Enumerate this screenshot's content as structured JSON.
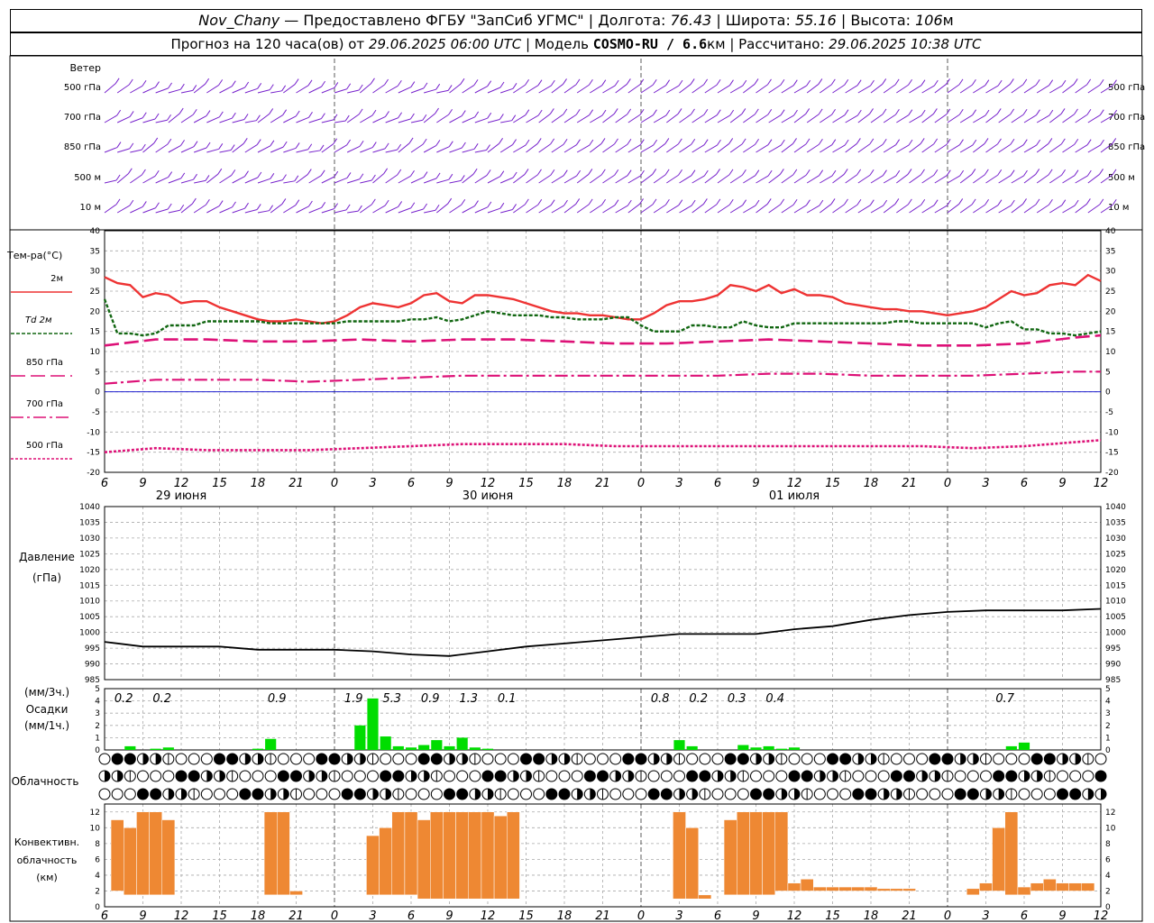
{
  "header": {
    "station": "Nov_Chany",
    "provider": " — Предоставлено ФГБУ \"ЗапСиб УГМС\" | ",
    "lon_label": "Долгота: ",
    "lon": "76.43",
    "lat_label": " | Широта: ",
    "lat": "55.16",
    "alt_label": " | Высота: ",
    "alt": "106",
    "alt_unit": "м",
    "forecast_label": "Прогноз на 120 часа(ов) от ",
    "forecast_from": "29.06.2025 06:00 UTC",
    "model_label": "  | Модель ",
    "model": "COSMO-RU / 6.6",
    "model_unit": "км",
    "calc_label": " | Рассчитано: ",
    "calc_time": "29.06.2025 10:38 UTC"
  },
  "colors": {
    "t2m": "#ee3333",
    "td2m": "#116611",
    "t850": "#dd1177",
    "t700": "#dd1177",
    "t500": "#dd1177",
    "pressure": "#000000",
    "precip": "#00dd00",
    "convective": "#ee8833",
    "wind": "#7722cc",
    "zero_line": "#0000cc"
  },
  "axis": {
    "time_ticks": [
      "6",
      "9",
      "12",
      "15",
      "18",
      "21",
      "0",
      "3",
      "6",
      "9",
      "12",
      "15",
      "18",
      "21",
      "0",
      "3",
      "6",
      "9",
      "12",
      "15",
      "18",
      "21",
      "0",
      "3",
      "6",
      "9",
      "12"
    ],
    "day_labels": [
      "29 июня",
      "30 июня",
      "01 июля"
    ],
    "day_boundaries_hours": [
      18,
      42,
      66
    ]
  },
  "wind_panel": {
    "title": "Ветер",
    "levels": [
      "500 гПа",
      "700 гПа",
      "850 гПа",
      "500 м",
      "10  м"
    ]
  },
  "cloud_panel": {
    "title": "Облачность"
  },
  "chart_data": [
    {
      "type": "line",
      "panel": "temperature",
      "title": "Тем-ра(°C)",
      "x_unit": "hours from 29.06.2025 06 UTC",
      "ylim": [
        -20,
        40
      ],
      "yticks": [
        40,
        35,
        30,
        25,
        20,
        15,
        10,
        5,
        0,
        -5,
        -10,
        -15,
        -20
      ],
      "series": [
        {
          "name": "2м",
          "x": [
            0,
            1,
            2,
            3,
            4,
            5,
            6,
            7,
            8,
            9,
            10,
            11,
            12,
            13,
            14,
            15,
            16,
            17,
            18,
            19,
            20,
            21,
            22,
            23,
            24,
            25,
            26,
            27,
            28,
            29,
            30,
            31,
            32,
            33,
            34,
            35,
            36,
            37,
            38,
            39,
            40,
            41,
            42,
            43,
            44,
            45,
            46,
            47,
            48,
            49,
            50,
            51,
            52,
            53,
            54,
            55,
            56,
            57,
            58,
            59,
            60,
            61,
            62,
            63,
            64,
            65,
            66,
            67,
            68,
            69,
            70,
            71,
            72,
            73,
            74,
            75,
            76,
            77,
            78
          ],
          "values": [
            28.5,
            27,
            26.5,
            23.5,
            24.5,
            24,
            22,
            22.5,
            22.5,
            21,
            20,
            19,
            18,
            17.5,
            17.5,
            18,
            17.5,
            17,
            17.5,
            19,
            21,
            22,
            21.5,
            21,
            22,
            24,
            24.5,
            22.5,
            22,
            24,
            24,
            23.5,
            23,
            22,
            21,
            20,
            19.5,
            19.5,
            19,
            19,
            18.5,
            18,
            18,
            19.5,
            21.5,
            22.5,
            22.5,
            23,
            24,
            26.5,
            26,
            25,
            26.5,
            24.5,
            25.5,
            24,
            24,
            23.5,
            22,
            21.5,
            21,
            20.5,
            20.5,
            20,
            20,
            19.5,
            19,
            19.5,
            20,
            21,
            23,
            25,
            24,
            24.5,
            26.5,
            27,
            26.5,
            29,
            27.5
          ]
        },
        {
          "name": "Td  2м",
          "x": [
            0,
            1,
            2,
            3,
            4,
            5,
            6,
            7,
            8,
            9,
            10,
            11,
            12,
            13,
            14,
            15,
            16,
            17,
            18,
            19,
            20,
            21,
            22,
            23,
            24,
            25,
            26,
            27,
            28,
            29,
            30,
            31,
            32,
            33,
            34,
            35,
            36,
            37,
            38,
            39,
            40,
            41,
            42,
            43,
            44,
            45,
            46,
            47,
            48,
            49,
            50,
            51,
            52,
            53,
            54,
            55,
            56,
            57,
            58,
            59,
            60,
            61,
            62,
            63,
            64,
            65,
            66,
            67,
            68,
            69,
            70,
            71,
            72,
            73,
            74,
            75,
            76,
            77,
            78
          ],
          "values": [
            23,
            14.5,
            14.5,
            14,
            14.5,
            16.5,
            16.5,
            16.5,
            17.5,
            17.5,
            17.5,
            17.5,
            17.5,
            17,
            17,
            17,
            17,
            17,
            17,
            17.5,
            17.5,
            17.5,
            17.5,
            17.5,
            18,
            18,
            18.5,
            17.5,
            18,
            19,
            20,
            19.5,
            19,
            19,
            19,
            18.5,
            18.5,
            18,
            18,
            18,
            18.5,
            18.5,
            16.5,
            15,
            15,
            15,
            16.5,
            16.5,
            16,
            16,
            17.5,
            16.5,
            16,
            16,
            17,
            17,
            17,
            17,
            17,
            17,
            17,
            17,
            17.5,
            17.5,
            17,
            17,
            17,
            17,
            17,
            16,
            17,
            17.5,
            15.5,
            15.5,
            14.5,
            14.5,
            14,
            14.5,
            15
          ]
        },
        {
          "name": "850  гПа",
          "x": [
            0,
            4,
            8,
            12,
            16,
            20,
            24,
            28,
            32,
            36,
            40,
            44,
            48,
            52,
            56,
            60,
            64,
            68,
            72,
            76,
            78
          ],
          "values": [
            11.5,
            13,
            13,
            12.5,
            12.5,
            13,
            12.5,
            13,
            13,
            12.5,
            12,
            12,
            12.5,
            13,
            12.5,
            12,
            11.5,
            11.5,
            12,
            13.5,
            14
          ]
        },
        {
          "name": "700  гПа",
          "x": [
            0,
            4,
            8,
            12,
            16,
            20,
            24,
            28,
            32,
            36,
            40,
            44,
            48,
            52,
            56,
            60,
            64,
            68,
            72,
            76,
            78
          ],
          "values": [
            2,
            3,
            3,
            3,
            2.5,
            3,
            3.5,
            4,
            4,
            4,
            4,
            4,
            4,
            4.5,
            4.5,
            4,
            4,
            4,
            4.5,
            5,
            5
          ]
        },
        {
          "name": "500  гПа",
          "x": [
            0,
            4,
            8,
            12,
            16,
            20,
            24,
            28,
            32,
            36,
            40,
            44,
            48,
            52,
            56,
            60,
            64,
            68,
            72,
            76,
            78
          ],
          "values": [
            -15,
            -14,
            -14.5,
            -14.5,
            -14.5,
            -14,
            -13.5,
            -13,
            -13,
            -13,
            -13.5,
            -13.5,
            -13.5,
            -13.5,
            -13.5,
            -13.5,
            -13.5,
            -14,
            -13.5,
            -12.5,
            -12
          ]
        }
      ]
    },
    {
      "type": "line",
      "panel": "pressure",
      "title": "Давление",
      "ylabel": "(гПа)",
      "ylim": [
        985,
        1040
      ],
      "yticks": [
        1040,
        1035,
        1030,
        1025,
        1020,
        1015,
        1010,
        1005,
        1000,
        995,
        990,
        985
      ],
      "series": [
        {
          "name": "Давление",
          "x": [
            0,
            3,
            6,
            9,
            12,
            15,
            18,
            21,
            24,
            27,
            30,
            33,
            36,
            39,
            42,
            45,
            48,
            51,
            54,
            57,
            60,
            63,
            66,
            69,
            72,
            75,
            78
          ],
          "values": [
            997,
            995.5,
            995.5,
            995.5,
            994.5,
            994.5,
            994.5,
            994,
            993,
            992.5,
            994,
            995.5,
            996.5,
            997.5,
            998.5,
            999.5,
            999.5,
            999.5,
            1001,
            1002,
            1004,
            1005.5,
            1006.5,
            1007,
            1007,
            1007,
            1007.5
          ]
        }
      ]
    },
    {
      "type": "bar",
      "panel": "precipitation",
      "title": "Осадки",
      "ylabel": "(мм/3ч.)",
      "ylabel2": "(мм/1ч.)",
      "ylim": [
        0,
        5
      ],
      "yticks": [
        5,
        4,
        3,
        2,
        1,
        0
      ],
      "hours": [
        2,
        4,
        5,
        12,
        13,
        20,
        21,
        22,
        23,
        24,
        25,
        26,
        27,
        28,
        29,
        30,
        45,
        46,
        50,
        51,
        52,
        53,
        54,
        71,
        72
      ],
      "values": [
        0.3,
        0.1,
        0.2,
        0.1,
        0.9,
        2,
        4.2,
        1.1,
        0.3,
        0.2,
        0.4,
        0.8,
        0.3,
        1,
        0.2,
        0.1,
        0.8,
        0.3,
        0.4,
        0.2,
        0.3,
        0.1,
        0.2,
        0.3,
        0.6
      ],
      "totals": [
        {
          "hour": 1.5,
          "label": "0.2"
        },
        {
          "hour": 4.5,
          "label": "0.2"
        },
        {
          "hour": 13.5,
          "label": "0.9"
        },
        {
          "hour": 19.5,
          "label": "1.9"
        },
        {
          "hour": 22.5,
          "label": "5.3"
        },
        {
          "hour": 25.5,
          "label": "0.9"
        },
        {
          "hour": 28.5,
          "label": "1.3"
        },
        {
          "hour": 31.5,
          "label": "0.1"
        },
        {
          "hour": 43.5,
          "label": "0.8"
        },
        {
          "hour": 46.5,
          "label": "0.2"
        },
        {
          "hour": 49.5,
          "label": "0.3"
        },
        {
          "hour": 52.5,
          "label": "0.4"
        },
        {
          "hour": 70.5,
          "label": "0.7"
        }
      ]
    },
    {
      "type": "bar",
      "panel": "convective_cloud",
      "title": "Конвективн.",
      "ylabel": "облачность",
      "ylabel2": "(км)",
      "ylim": [
        0,
        13
      ],
      "yticks": [
        12,
        10,
        8,
        6,
        4,
        2,
        0
      ],
      "hours": [
        1,
        2,
        3,
        4,
        5,
        13,
        14,
        15,
        21,
        22,
        23,
        24,
        25,
        26,
        27,
        28,
        29,
        30,
        31,
        32,
        45,
        46,
        47,
        49,
        50,
        51,
        52,
        53,
        54,
        55,
        56,
        57,
        58,
        59,
        60,
        61,
        62,
        63,
        64,
        65,
        67,
        68,
        69,
        70,
        71,
        72,
        73,
        74,
        75,
        76,
        77
      ],
      "bottoms": [
        2,
        1.5,
        1.5,
        1.5,
        1.5,
        1.5,
        1.5,
        1.5,
        1.5,
        1.5,
        1.5,
        1.5,
        1,
        1,
        1,
        1,
        1,
        1,
        1,
        1,
        1,
        1,
        1,
        1.5,
        1.5,
        1.5,
        1.5,
        2,
        2,
        2,
        2,
        2,
        2,
        2,
        2,
        2,
        2,
        2,
        2,
        2,
        1.5,
        1.5,
        2,
        2,
        1.5,
        1.5,
        2,
        2,
        2,
        2,
        2
      ],
      "tops": [
        11,
        10,
        12,
        12,
        11,
        12,
        12,
        2,
        9,
        10,
        12,
        12,
        11,
        12,
        12,
        12,
        12,
        12,
        11.5,
        12,
        12,
        10,
        1.5,
        11,
        12,
        12,
        12,
        12,
        3,
        3.5,
        2.5,
        2.5,
        2.5,
        2.5,
        2.5,
        2.3,
        2.3,
        2.3,
        2,
        1.8,
        1.5,
        2.3,
        3,
        10,
        12,
        2.5,
        3,
        3.5,
        3,
        3,
        3
      ]
    }
  ]
}
